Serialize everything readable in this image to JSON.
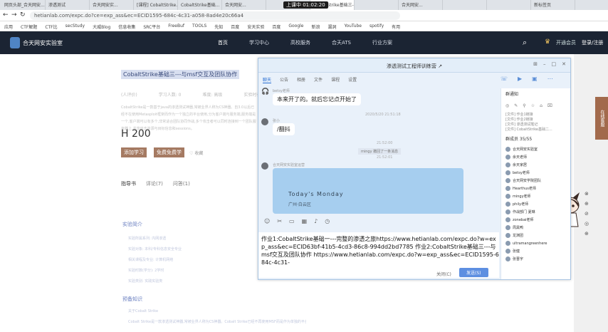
{
  "browser": {
    "tabs": [
      "网页头部_合天网安...",
      "渗透测试",
      "合天网安实...",
      "[课程] CobaltStrike...",
      "CobaltStrike基础...",
      "合天网安...",
      "",
      "CobaltStrike基础三-...",
      "",
      "合天网安...",
      "",
      "",
      "新标签页"
    ],
    "active_tab_index": 8,
    "recording_time": "上课中 01:02:20",
    "url": "hetianlab.com/expc.do?ce=exp_ass&ec=ECID1595-684c-4c31-a058-8ad4e20c66a4",
    "bookmarks": [
      "应用",
      "CTF解题",
      "CTF比",
      "secStudy",
      "大威Blog",
      "信息收集",
      "SRC平台",
      "FreeBuf",
      "TOOLS",
      "先知",
      "百度",
      "安天实验",
      "百度",
      "Google",
      "新浪",
      "漏洞",
      "YouTube",
      "spotify",
      "有用"
    ]
  },
  "site": {
    "name": "合天网安实验室",
    "nav": [
      "首页",
      "学习中心",
      "高校服务",
      "合天ATS",
      "行业方案"
    ],
    "vip_label": "开通会员",
    "login_label": "登录/注册"
  },
  "course": {
    "title": "CobaltStrike基础三---与msf交互及团队协作",
    "meta": [
      "(人评价)",
      "学习人数: 0",
      "难度: 高级",
      "实验时长: 40分钟"
    ],
    "description": "CobaltStrike是一款基于java的渗透测试神器,常被业界人称为CS神器。自3.0以后已经不在使用Metasploit框架而作为一个独立的平台使用,分为客户端与服务端,服务端是一个,客户端可以有多个,非常适合团队协同作战,多个攻击者可以同时连接到一个团队服务器上,共享攻击资源与目标信息和sessions。",
    "price_label": "H",
    "price": "200",
    "add_button": "添加学习",
    "free_button": "免费免费学",
    "fav_label": "收藏",
    "tabs": [
      "指导书",
      "评论(7)",
      "问答(1)"
    ],
    "exp_intro_title": "实验简介",
    "exp_intro_items": [
      "实验所属系列: 内网渗透",
      "实验对象: 本科/专科信息安全专业",
      "相关课程及专业: 计算机网络",
      "实验时数(学分): 2学时",
      "实验类别: 实践实验类"
    ],
    "prereq_title": "预备知识",
    "prereq_item": "关于Cobalt Strike",
    "prereq_text": "Cobalt Strike是一款渗透测试神器,常被业界人称为CS神器。Cobalt Strike已经不再使用MSF而是作为单独的平台使用..."
  },
  "sidebar": {
    "tab_label": "在线客服"
  },
  "chat": {
    "group_title": "渗透测试工程师训练营 ↗",
    "tabs": [
      "聊天",
      "公告",
      "相册",
      "文件",
      "课程",
      "设置"
    ],
    "messages": [
      {
        "sender": "betsy老师",
        "text": "本来开了的。就后忘记点开始了",
        "time": "2020/5/20 21:51:18"
      },
      {
        "sender": "张小",
        "text": "/翻抖"
      }
    ],
    "sys_time": "21:52:00",
    "sys_note": "mingy 撤回了一条消息",
    "sys_time2": "21:52:01",
    "image_sender": "合天网安实验室运营",
    "image_text": "Today's Monday",
    "image_location": "广州·白云区",
    "input_text": "作业1:CobaltStrike基础一---完整的渗透之旅https://www.hetianlab.com/expc.do?w=exp_ass&ec=ECID63bf-41b5-4cd3-86c8-994dd2bd7785\n作业2:CobaltStrike基础三---与msf交互及团队协作\nhttps://www.hetianlab.com/expc.do?w=exp_ass&ec=ECID1595-684c-4c31-",
    "close_label": "关闭(C)",
    "send_label": "发送(S)",
    "announce_title": "群通知",
    "announce_text": "[文件] 作业1链接\n[文件] 作业2链接\n[文件] 渗透测试笔记\n[文件] CobaltStrike基础二...",
    "member_title": "群成员 35/55",
    "members": [
      "合天网安实验室",
      "余天老师",
      "余天家居",
      "betsy老师",
      "合天网安学院团队",
      "Hearthus老师",
      "mingy老师",
      "phily老师",
      "作战部门 夏琳",
      "zonebai老师",
      "周黑鸭",
      "龙渊团",
      "ultramangreenhere",
      "张健",
      "张晋宇"
    ]
  }
}
